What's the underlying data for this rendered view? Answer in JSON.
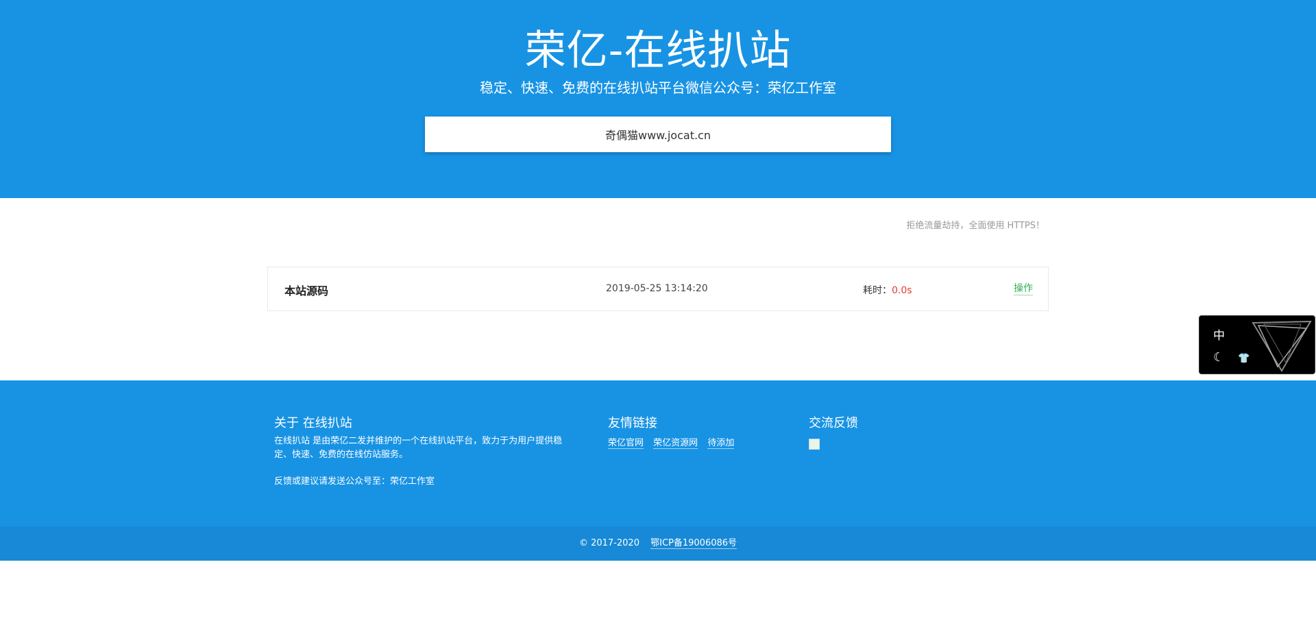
{
  "header": {
    "title": "荣亿-在线扒站",
    "subtitle": "稳定、快速、免费的在线扒站平台微信公众号：荣亿工作室",
    "search_value": "奇偶猫www.jocat.cn"
  },
  "notice": "拒绝流量劫持，全面使用 HTTPS！",
  "card": {
    "name": "本站源码",
    "time": "2019-05-25 13:14:20",
    "cost_label": "耗时：",
    "cost_value": "0.0s",
    "op_label": "操作"
  },
  "widget": {
    "lang": "中",
    "moon_icon": "moon-icon",
    "shirt_icon": "shirt-icon"
  },
  "footer": {
    "about_title": "关于 在线扒站",
    "about_text": "在线扒站 是由荣亿二发并维护的一个在线扒站平台，致力于为用户提供稳定、快速、免费的在线仿站服务。",
    "feedback_text": "反馈或建议请发送公众号至：荣亿工作室",
    "links_title": "友情链接",
    "links": [
      "荣亿官网",
      "荣亿资源网",
      "待添加"
    ],
    "contact_title": "交流反馈"
  },
  "bottom": {
    "copyright": "© 2017-2020",
    "icp": "鄂ICP备19006086号"
  },
  "colors": {
    "primary": "#1893e4",
    "bottom_bar": "#1789d6",
    "op_green": "#32b054",
    "cost_red": "#e53935"
  }
}
